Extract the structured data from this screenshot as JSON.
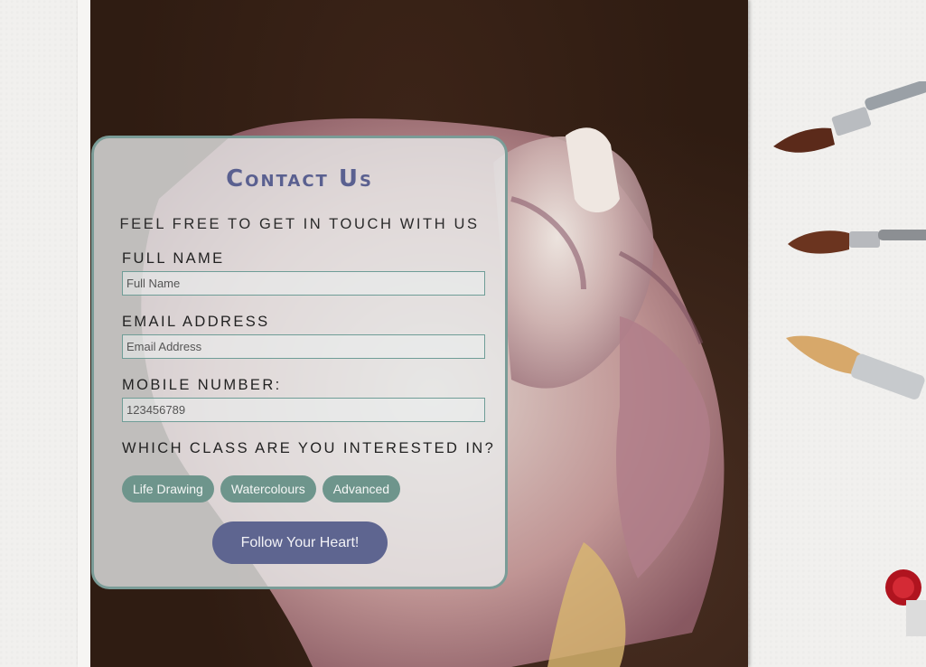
{
  "header": {
    "title": "Contact Us",
    "subtitle": "FEEL FREE TO GET IN TOUCH WITH US"
  },
  "form": {
    "full_name": {
      "label": "FULL NAME",
      "placeholder": "Full Name",
      "value": ""
    },
    "email": {
      "label": "EMAIL ADDRESS",
      "placeholder": "Email Address",
      "value": ""
    },
    "mobile": {
      "label": "MOBILE NUMBER:",
      "placeholder": "123456789",
      "value": ""
    },
    "class_question": "WHICH CLASS ARE YOU INTERESTED IN?",
    "class_options": [
      "Life Drawing",
      "Watercolours",
      "Advanced"
    ],
    "submit_label": "Follow Your Heart!"
  },
  "colors": {
    "title": "#5a6090",
    "chip": "#6e958c",
    "submit": "#5e6590",
    "card_border": "#7a9c97"
  }
}
